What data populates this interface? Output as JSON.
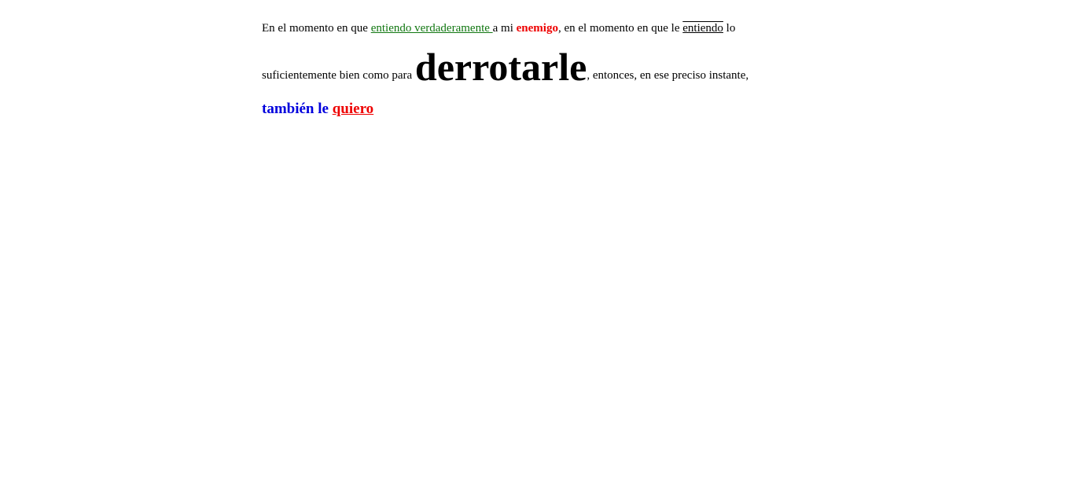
{
  "paragraph": {
    "line1": {
      "t1": "En el momento en que ",
      "highlight1": "entiendo verdaderamente ",
      "t2": "a mi ",
      "emphasis1": "enemigo",
      "t3": ", en el momento en que le ",
      "overunder": "entiendo",
      "t4": " lo"
    },
    "line2": {
      "t1": "suficientemente bien como para ",
      "big": "derrotarle",
      "t2": ", entonces, en ese preciso instante,"
    },
    "line3": {
      "blue": "también le ",
      "red": "quiero"
    }
  },
  "colors": {
    "green": "#117711",
    "red": "#ee0000",
    "blue": "#0000dd"
  }
}
